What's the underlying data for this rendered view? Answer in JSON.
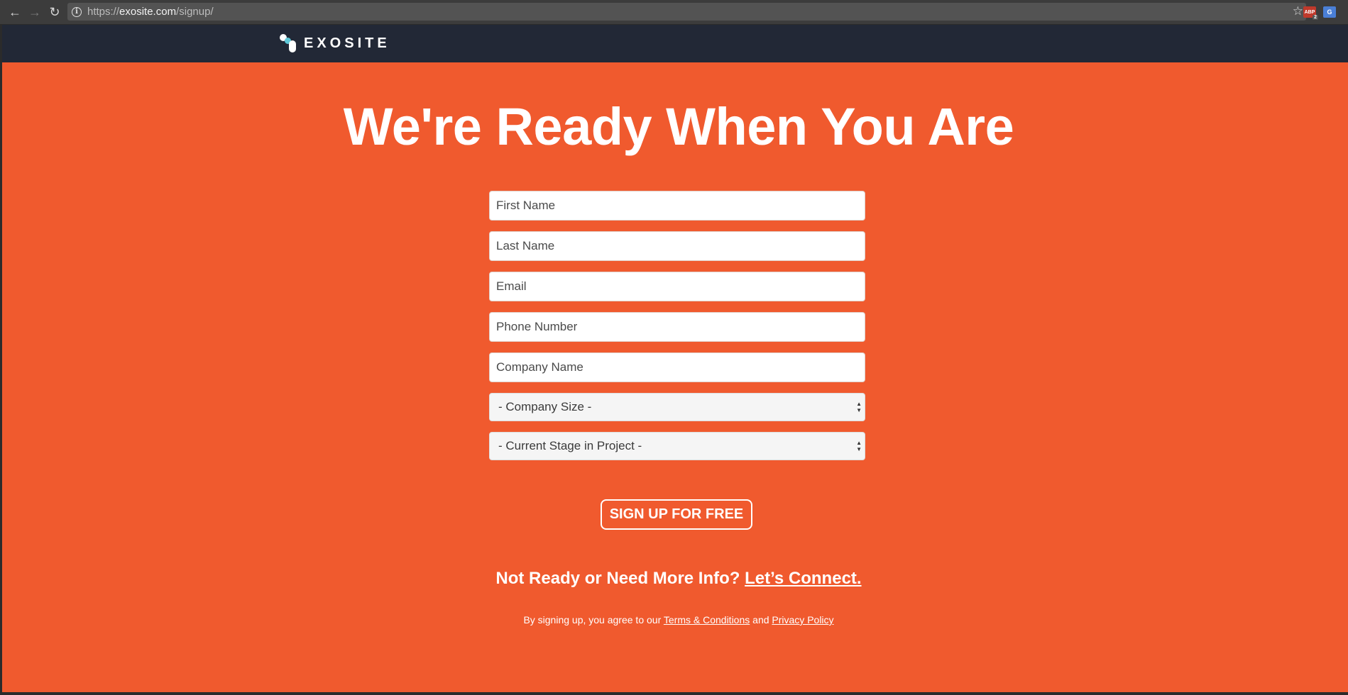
{
  "browser": {
    "back_icon": "←",
    "forward_icon": "→",
    "reload_icon": "↻",
    "info_icon": "i",
    "url_scheme": "https://",
    "url_host": "exosite.com",
    "url_path": "/signup/",
    "star_icon": "☆",
    "ext_abp_label": "ABP",
    "ext_abp_badge": "2",
    "ext_translate_label": "G"
  },
  "header": {
    "logo_text": "EXOSITE"
  },
  "main": {
    "headline": "We're Ready When You Are",
    "background_color": "#f05a2e",
    "form": {
      "first_name_placeholder": "First Name",
      "last_name_placeholder": "Last Name",
      "email_placeholder": "Email",
      "phone_placeholder": "Phone Number",
      "company_placeholder": "Company Name",
      "company_size_selected": "- Company Size -",
      "project_stage_selected": "- Current Stage in Project -",
      "submit_label": "SIGN UP FOR FREE"
    },
    "connect": {
      "prefix": "Not Ready or Need More Info? ",
      "link": "Let’s Connect."
    },
    "legal": {
      "prefix": "By signing up, you agree to our ",
      "terms_link": "Terms & Conditions",
      "middle": " and ",
      "privacy_link": "Privacy Policy"
    }
  }
}
